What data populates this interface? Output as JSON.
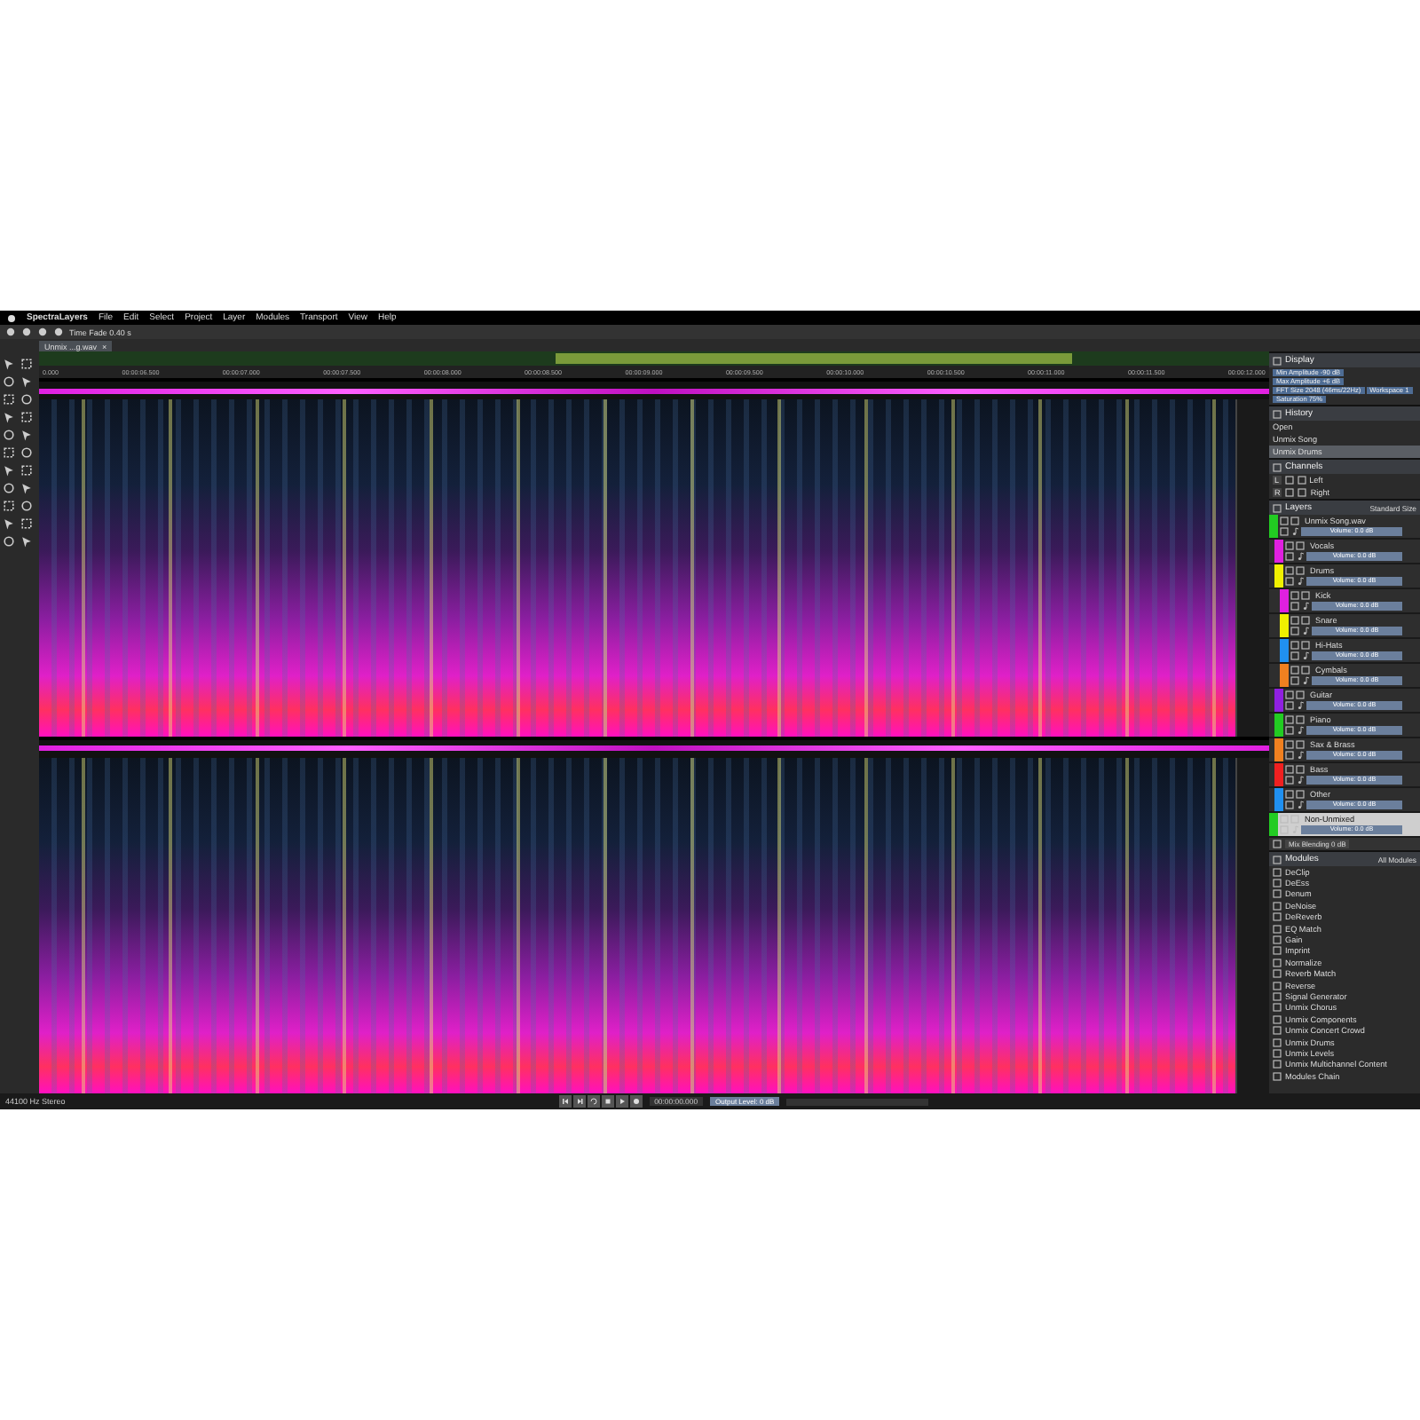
{
  "menu_bar": {
    "app_name": "SpectraLayers",
    "items": [
      "File",
      "Edit",
      "Select",
      "Project",
      "Layer",
      "Modules",
      "Transport",
      "View",
      "Help"
    ]
  },
  "toolbar": {
    "time_fade": "Time Fade 0.40 s"
  },
  "tabs": [
    {
      "label": "Unmix ...g.wav",
      "close": "×",
      "selected": true
    }
  ],
  "timeline": {
    "ticks": [
      "0.000",
      "00:00:06.500",
      "00:00:07.000",
      "00:00:07.500",
      "00:00:08.000",
      "00:00:08.500",
      "00:00:09.000",
      "00:00:09.500",
      "00:00:10.000",
      "00:00:10.500",
      "00:00:11.000",
      "00:00:11.500",
      "00:00:12.000"
    ]
  },
  "display": {
    "title": "Display",
    "fields": [
      "Min Amplitude -90 dB",
      "Max Amplitude +6 dB",
      "FFT Size 2048 (46ms/22Hz)",
      "Workspace 1",
      "Saturation 75%"
    ]
  },
  "history": {
    "title": "History",
    "items": [
      {
        "label": "Open",
        "selected": false
      },
      {
        "label": "Unmix Song",
        "selected": false
      },
      {
        "label": "Unmix Drums",
        "selected": true
      }
    ]
  },
  "channels": {
    "title": "Channels",
    "items": [
      {
        "letter": "L",
        "name": "Left"
      },
      {
        "letter": "R",
        "name": "Right"
      }
    ]
  },
  "layers": {
    "title": "Layers",
    "size_mode": "Standard Size",
    "items": [
      {
        "name": "Unmix Song.wav",
        "color": "#22cc22",
        "volume": "Volume: 0.0 dB",
        "selected": false,
        "children": [
          {
            "name": "Vocals",
            "color": "#e020e0",
            "volume": "Volume: 0.0 dB",
            "selected": false
          },
          {
            "name": "Drums",
            "color": "#f0f000",
            "volume": "Volume: 0.0 dB",
            "selected": false,
            "children": [
              {
                "name": "Kick",
                "color": "#e020e0",
                "volume": "Volume: 0.0 dB",
                "selected": false
              },
              {
                "name": "Snare",
                "color": "#f0f000",
                "volume": "Volume: 0.0 dB",
                "selected": false
              },
              {
                "name": "Hi-Hats",
                "color": "#2090f0",
                "volume": "Volume: 0.0 dB",
                "selected": false
              },
              {
                "name": "Cymbals",
                "color": "#f08020",
                "volume": "Volume: 0.0 dB",
                "selected": false
              }
            ]
          },
          {
            "name": "Guitar",
            "color": "#9020e0",
            "volume": "Volume: 0.0 dB",
            "selected": false
          },
          {
            "name": "Piano",
            "color": "#22cc22",
            "volume": "Volume: 0.0 dB",
            "selected": false
          },
          {
            "name": "Sax & Brass",
            "color": "#f08020",
            "volume": "Volume: 0.0 dB",
            "selected": false
          },
          {
            "name": "Bass",
            "color": "#f02020",
            "volume": "Volume: 0.0 dB",
            "selected": false
          },
          {
            "name": "Other",
            "color": "#2090f0",
            "volume": "Volume: 0.0 dB",
            "selected": false
          }
        ]
      },
      {
        "name": "Non-Unmixed",
        "color": "#22cc22",
        "volume": "Volume: 0.0 dB",
        "selected": true
      }
    ],
    "blending": "Mix Blending 0 dB"
  },
  "modules": {
    "title": "Modules",
    "filter": "All Modules",
    "items": [
      "DeClip",
      "DeEss",
      "Denum",
      "DeNoise",
      "DeReverb",
      "EQ Match",
      "Gain",
      "Imprint",
      "Normalize",
      "Reverb Match",
      "Reverse",
      "Signal Generator",
      "Unmix Chorus",
      "Unmix Components",
      "Unmix Concert Crowd",
      "Unmix Drums",
      "Unmix Levels",
      "Unmix Multichannel Content",
      "Modules Chain"
    ]
  },
  "status_bar": {
    "format": "44100 Hz Stereo",
    "time": "00:00:00.000",
    "output_level": "Output Level: 0 dB"
  }
}
